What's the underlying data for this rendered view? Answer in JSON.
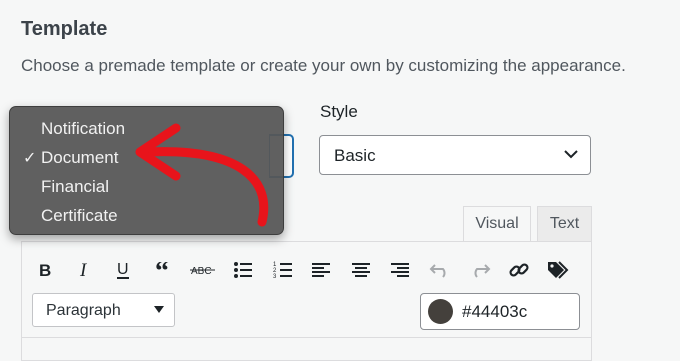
{
  "section": {
    "title": "Template",
    "description": "Choose a premade template or create your own by customizing the appearance."
  },
  "template_dropdown": {
    "options": [
      "Notification",
      "Document",
      "Financial",
      "Certificate"
    ],
    "selected": "Document",
    "check_glyph": "✓"
  },
  "style": {
    "label": "Style",
    "value": "Basic"
  },
  "editor": {
    "tabs": {
      "visual": "Visual",
      "text": "Text"
    },
    "active_tab": "Visual",
    "toolbar": [
      "bold-icon",
      "italic-icon",
      "underline-icon",
      "blockquote-icon",
      "strikethrough-icon",
      "bullet-list-icon",
      "numbered-list-icon",
      "align-left-icon",
      "align-center-icon",
      "align-right-icon",
      "undo-icon",
      "redo-icon",
      "link-icon",
      "tags-icon"
    ],
    "format": "Paragraph",
    "text_color": "#44403c"
  },
  "colors": {
    "annotation_arrow": "#e8141b",
    "focus": "#2271b1"
  }
}
